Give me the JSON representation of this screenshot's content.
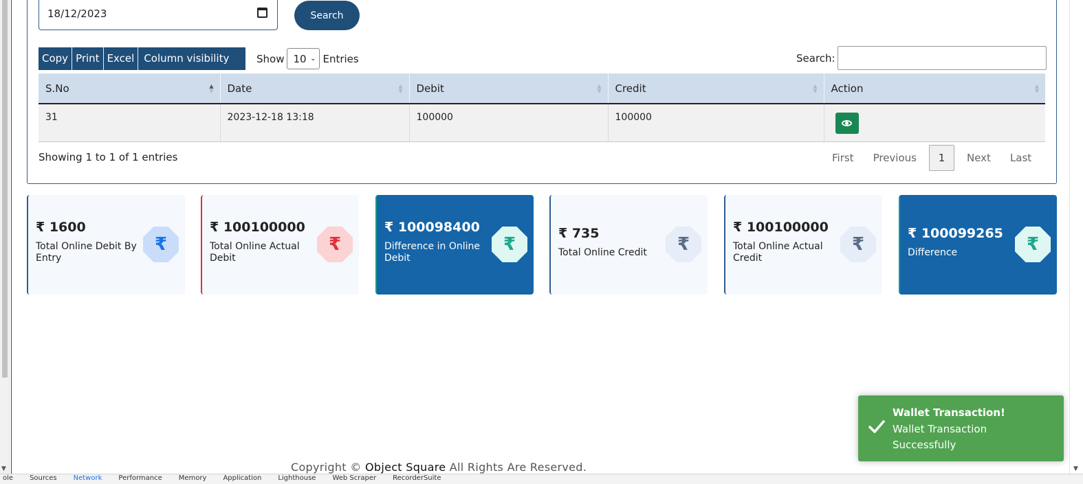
{
  "filter": {
    "date_value": "18/12/2023",
    "search_button": "Search"
  },
  "toolbar": {
    "buttons": [
      "Copy",
      "Print",
      "Excel",
      "Column visibility"
    ],
    "show_label": "Show",
    "page_length": "10",
    "entries_label": "Entries",
    "search_label": "Search:",
    "search_value": ""
  },
  "table": {
    "columns": [
      "S.No",
      "Date",
      "Debit",
      "Credit",
      "Action"
    ],
    "rows": [
      {
        "sno": "31",
        "date": "2023-12-18 13:18",
        "debit": "100000",
        "credit": "100000"
      }
    ]
  },
  "info": "Showing 1 to 1 of 1 entries",
  "pagination": {
    "first": "First",
    "previous": "Previous",
    "current": "1",
    "next": "Next",
    "last": "Last"
  },
  "tiles": [
    {
      "amount": "₹ 1600",
      "label": "Total Online Debit By Entry",
      "symbol": "₹",
      "accent": "#2c5d8f",
      "icon_bg": "#c9ddfb",
      "icon_color": "#1a73e8",
      "dark": false
    },
    {
      "amount": "₹ 100100000",
      "label": "Total Online Actual Debit",
      "symbol": "₹",
      "accent": "#e0303a",
      "icon_bg": "#fbd3d3",
      "icon_color": "#e0303a",
      "dark": false
    },
    {
      "amount": "₹ 100098400",
      "label": "Difference in Online Debit",
      "symbol": "₹",
      "accent": "#1a9a86",
      "icon_bg": "#dff7f2",
      "icon_color": "#1aa78c",
      "dark": true
    },
    {
      "amount": "₹ 735",
      "label": "Total Online Credit",
      "symbol": "₹",
      "accent": "#2c5d8f",
      "icon_bg": "#e6edf8",
      "icon_color": "#5a6b85",
      "dark": false
    },
    {
      "amount": "₹ 100100000",
      "label": "Total Online Actual Credit",
      "symbol": "₹",
      "accent": "#2c5d8f",
      "icon_bg": "#e6edf8",
      "icon_color": "#5a6b85",
      "dark": false
    },
    {
      "amount": "₹ 100099265",
      "label": "Difference",
      "symbol": "₹",
      "accent": "#1a9a86",
      "icon_bg": "#dff7f2",
      "icon_color": "#1aa78c",
      "dark": true
    }
  ],
  "footer": {
    "prefix": "Copyright ©",
    "brand": "Object Square",
    "suffix": "All Rights Are Reserved."
  },
  "toast": {
    "title": "Wallet Transaction!",
    "message": "Wallet Transaction Successfully"
  },
  "devtools": {
    "tabs": [
      "ole",
      "Sources",
      "Network",
      "Performance",
      "Memory",
      "Application",
      "Lighthouse",
      "Web Scraper",
      "RecorderSuite"
    ]
  }
}
